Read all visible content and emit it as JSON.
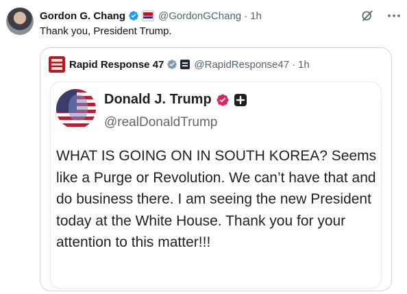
{
  "tweet": {
    "author_name": "Gordon G. Chang",
    "author_handle": "@GordonGChang",
    "separator": "·",
    "time": "1h",
    "text": "Thank you, President Trump.",
    "icons": [
      "verified-badge-icon",
      "affiliate-flag-icon",
      "grok-icon",
      "more-icon"
    ]
  },
  "quote": {
    "author_name": "Rapid Response 47",
    "author_handle": "@RapidResponse47",
    "separator": "·",
    "time": "1h",
    "icons": [
      "rapid-response-avatar",
      "gray-verified-badge-icon",
      "government-badge-icon"
    ]
  },
  "truth_card": {
    "name": "Donald J. Trump",
    "handle": "@realDonaldTrump",
    "text": "WHAT IS GOING ON IN SOUTH KOREA? Seems like a Purge or Revolution. We can’t have that and do business there. I am seeing the new President today at the White House. Thank you for your attention to this matter!!!",
    "icons": [
      "verified-badge-icon",
      "plus-badge-icon"
    ]
  },
  "colors": {
    "text_primary": "#0f1419",
    "text_secondary": "#536471",
    "verified_blue": "#1d9bf0",
    "verified_gray": "#829aab",
    "truth_verified": "#e0245e",
    "border": "#cfd9de"
  }
}
